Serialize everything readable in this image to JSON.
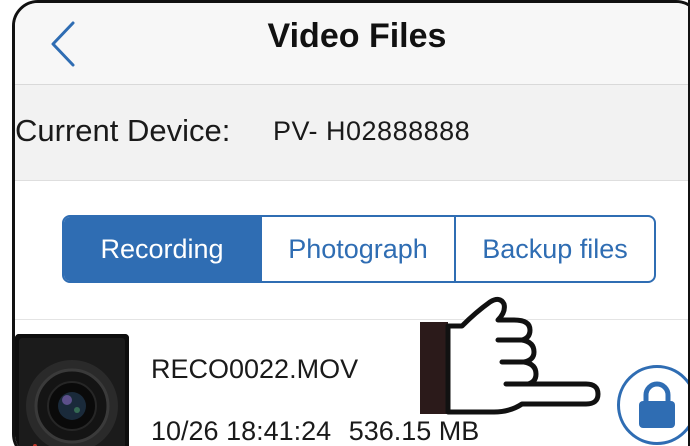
{
  "nav": {
    "title": "Video Files",
    "back_icon": "chevron-left-icon"
  },
  "device": {
    "label": "Current Device:",
    "value": "PV- H02888888"
  },
  "tabs": [
    {
      "label": "Recording",
      "active": true
    },
    {
      "label": "Photograph",
      "active": false
    },
    {
      "label": "Backup files",
      "active": false
    }
  ],
  "files": [
    {
      "name": "RECO0022.MOV",
      "datetime": "10/26 18:41:24",
      "size": "536.15 MB",
      "action_icon": "lock-icon"
    }
  ],
  "colors": {
    "accent": "#2f6db3",
    "nav_background": "#f7f7f7",
    "device_row_background": "#f2f2f2"
  },
  "overlay": {
    "icon": "pointing-hand-icon"
  }
}
